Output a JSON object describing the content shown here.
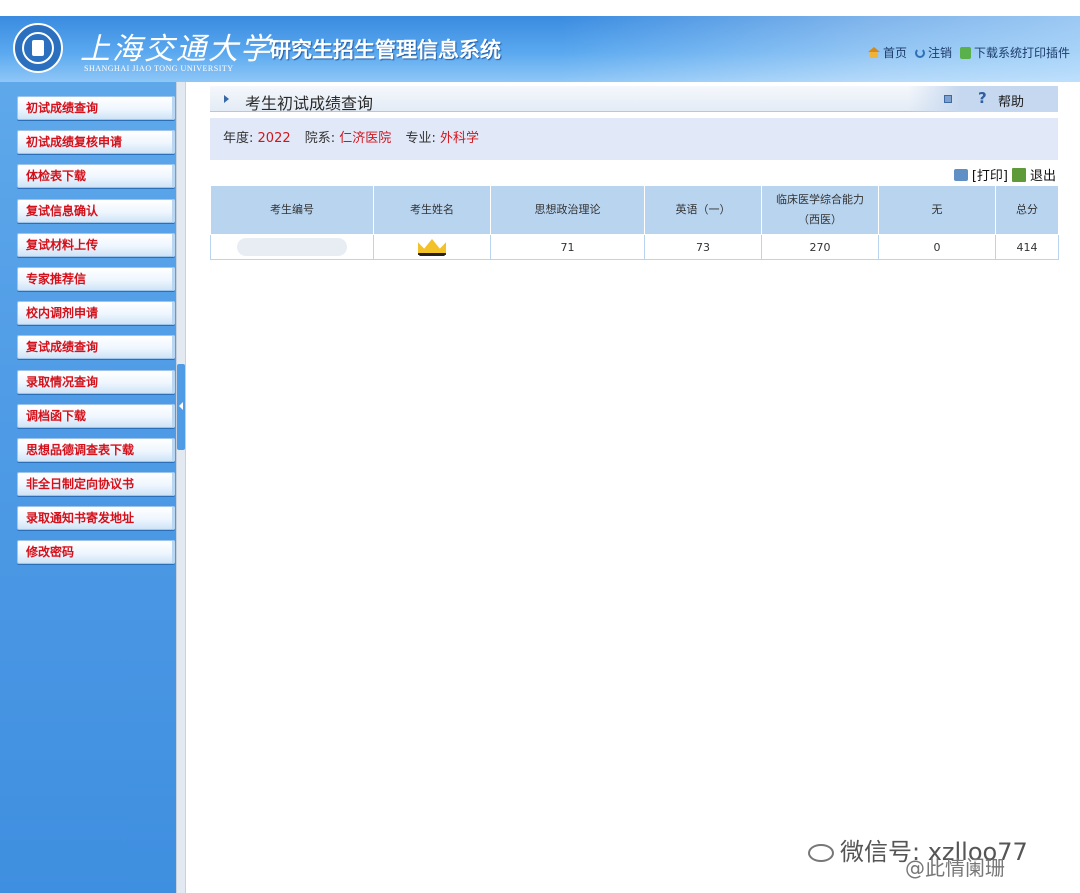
{
  "header": {
    "university_cn": "上海交通大学",
    "university_en": "SHANGHAI JIAO TONG UNIVERSITY",
    "system_title": "研究生招生管理信息系统",
    "links": {
      "home": "首页",
      "logout": "注销",
      "download_plugin": "下载系统打印插件"
    }
  },
  "sidebar": {
    "items": [
      "初试成绩查询",
      "初试成绩复核申请",
      "体检表下载",
      "复试信息确认",
      "复试材料上传",
      "专家推荐信",
      "校内调剂申请",
      "复试成绩查询",
      "录取情况查询",
      "调档函下载",
      "思想品德调查表下载",
      "非全日制定向协议书",
      "录取通知书寄发地址",
      "修改密码"
    ]
  },
  "content": {
    "title": "考生初试成绩查询",
    "help": "帮助",
    "info": {
      "year_label": "年度:",
      "year": "2022",
      "dept_label": "院系:",
      "dept": "仁济医院",
      "major_label": "专业:",
      "major": "外科学"
    },
    "print_label": "[打印]",
    "exit_label": "退出",
    "table": {
      "headers": [
        "考生编号",
        "考生姓名",
        "思想政治理论",
        "英语（一）",
        "临床医学综合能力（西医）",
        "无",
        "总分"
      ],
      "row": {
        "politics": "71",
        "english": "73",
        "clinical": "270",
        "none": "0",
        "total": "414"
      }
    }
  },
  "watermark": {
    "wechat": "微信号: xzlloo77",
    "weibo": "@此情阑珊"
  },
  "colors": {
    "accent": "#4f9be6",
    "menu_text": "#d4111a",
    "table_header": "#b9d4ef"
  }
}
